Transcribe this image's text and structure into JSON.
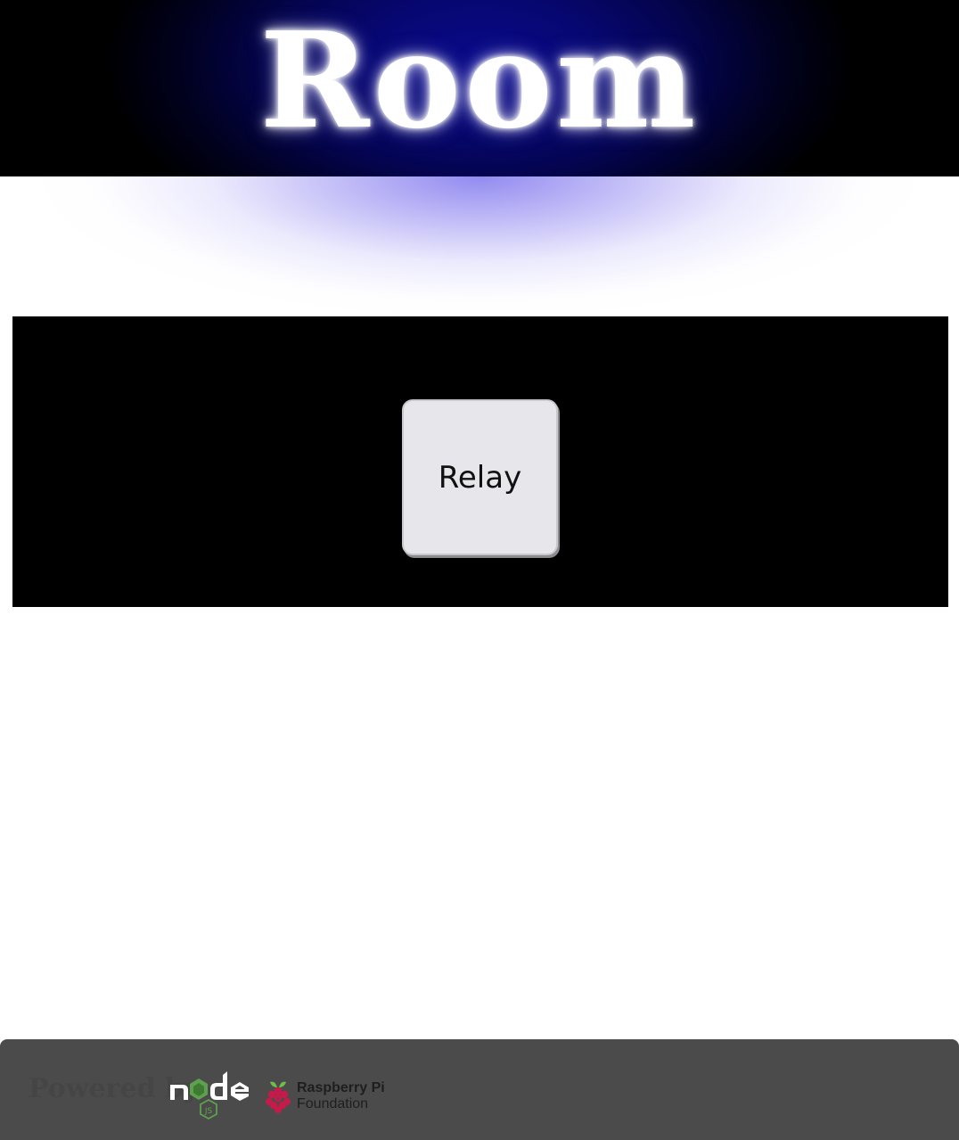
{
  "header": {
    "title": "Room"
  },
  "panel": {
    "relay_button_label": "Relay"
  },
  "footer": {
    "powered_by": "Powered by",
    "logos": {
      "node": {
        "icon": "nodejs-logo",
        "wordmark": "node",
        "sub": "JS"
      },
      "raspberry": {
        "icon": "raspberry-pi-logo",
        "line1": "Raspberry Pi",
        "line2": "Foundation"
      }
    }
  },
  "colors": {
    "header_glow": "#0a0a8a",
    "panel_background": "#000000",
    "button_background": "#e7e6eb",
    "footer_background": "#4b4b4b",
    "node_green": "#5fa04e",
    "raspberry_red": "#c51a4a",
    "raspberry_leaf": "#6cc04a"
  }
}
